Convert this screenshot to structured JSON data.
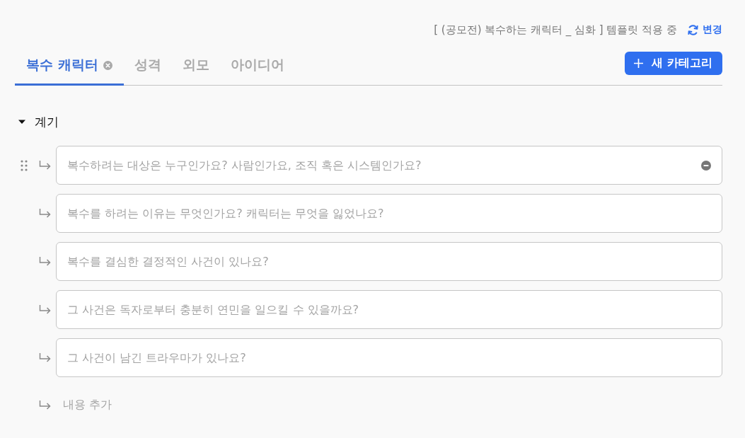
{
  "template_notice": {
    "text": "[ (공모전) 복수하는 캐릭터 _ 심화 ] 템플릿 적용 중",
    "change_label": "변경"
  },
  "tabs": [
    {
      "label": "복수 캐릭터",
      "selected": true
    },
    {
      "label": "성격",
      "selected": false
    },
    {
      "label": "외모",
      "selected": false
    },
    {
      "label": "아이디어",
      "selected": false
    }
  ],
  "new_category_button": {
    "label": "새 카테고리"
  },
  "sections": [
    {
      "title": "계기",
      "expanded": true,
      "items": [
        {
          "placeholder": "복수하려는 대상은 누구인가요? 사람인가요, 조직 혹은 시스템인가요?",
          "hovered": true
        },
        {
          "placeholder": "복수를 하려는 이유는 무엇인가요? 캐릭터는 무엇을 잃었나요?",
          "hovered": false
        },
        {
          "placeholder": "복수를 결심한 결정적인 사건이 있나요?",
          "hovered": false
        },
        {
          "placeholder": "그 사건은 독자로부터 충분히 연민을 일으킬 수 있을까요?",
          "hovered": false
        },
        {
          "placeholder": "그 사건이 남긴 트라우마가 있나요?",
          "hovered": false
        }
      ],
      "add_item_label": "내용 추가"
    }
  ]
}
